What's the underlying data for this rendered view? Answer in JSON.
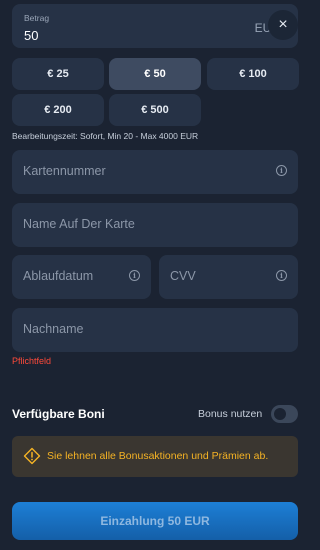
{
  "amount": {
    "label": "Betrag",
    "value": "50",
    "currency": "EUR",
    "clear_icon": "×"
  },
  "presets": [
    {
      "label": "€ 25"
    },
    {
      "label": "€ 50"
    },
    {
      "label": "€ 100"
    },
    {
      "label": "€ 200"
    },
    {
      "label": "€ 500"
    }
  ],
  "hint": "Bearbeitungszeit: Sofort, Min 20 - Max 4000 EUR",
  "fields": {
    "card_number": "Kartennummer",
    "card_name": "Name Auf Der Karte",
    "expiry": "Ablaufdatum",
    "cvv": "CVV",
    "lastname": "Nachname"
  },
  "info_glyph": "i",
  "required_text": "Pflichtfeld",
  "bonus": {
    "title": "Verfügbare Boni",
    "toggle_label": "Bonus nutzen",
    "warning": "Sie lehnen alle Bonusaktionen und Prämien ab."
  },
  "deposit_button": "Einzahlung 50 EUR"
}
